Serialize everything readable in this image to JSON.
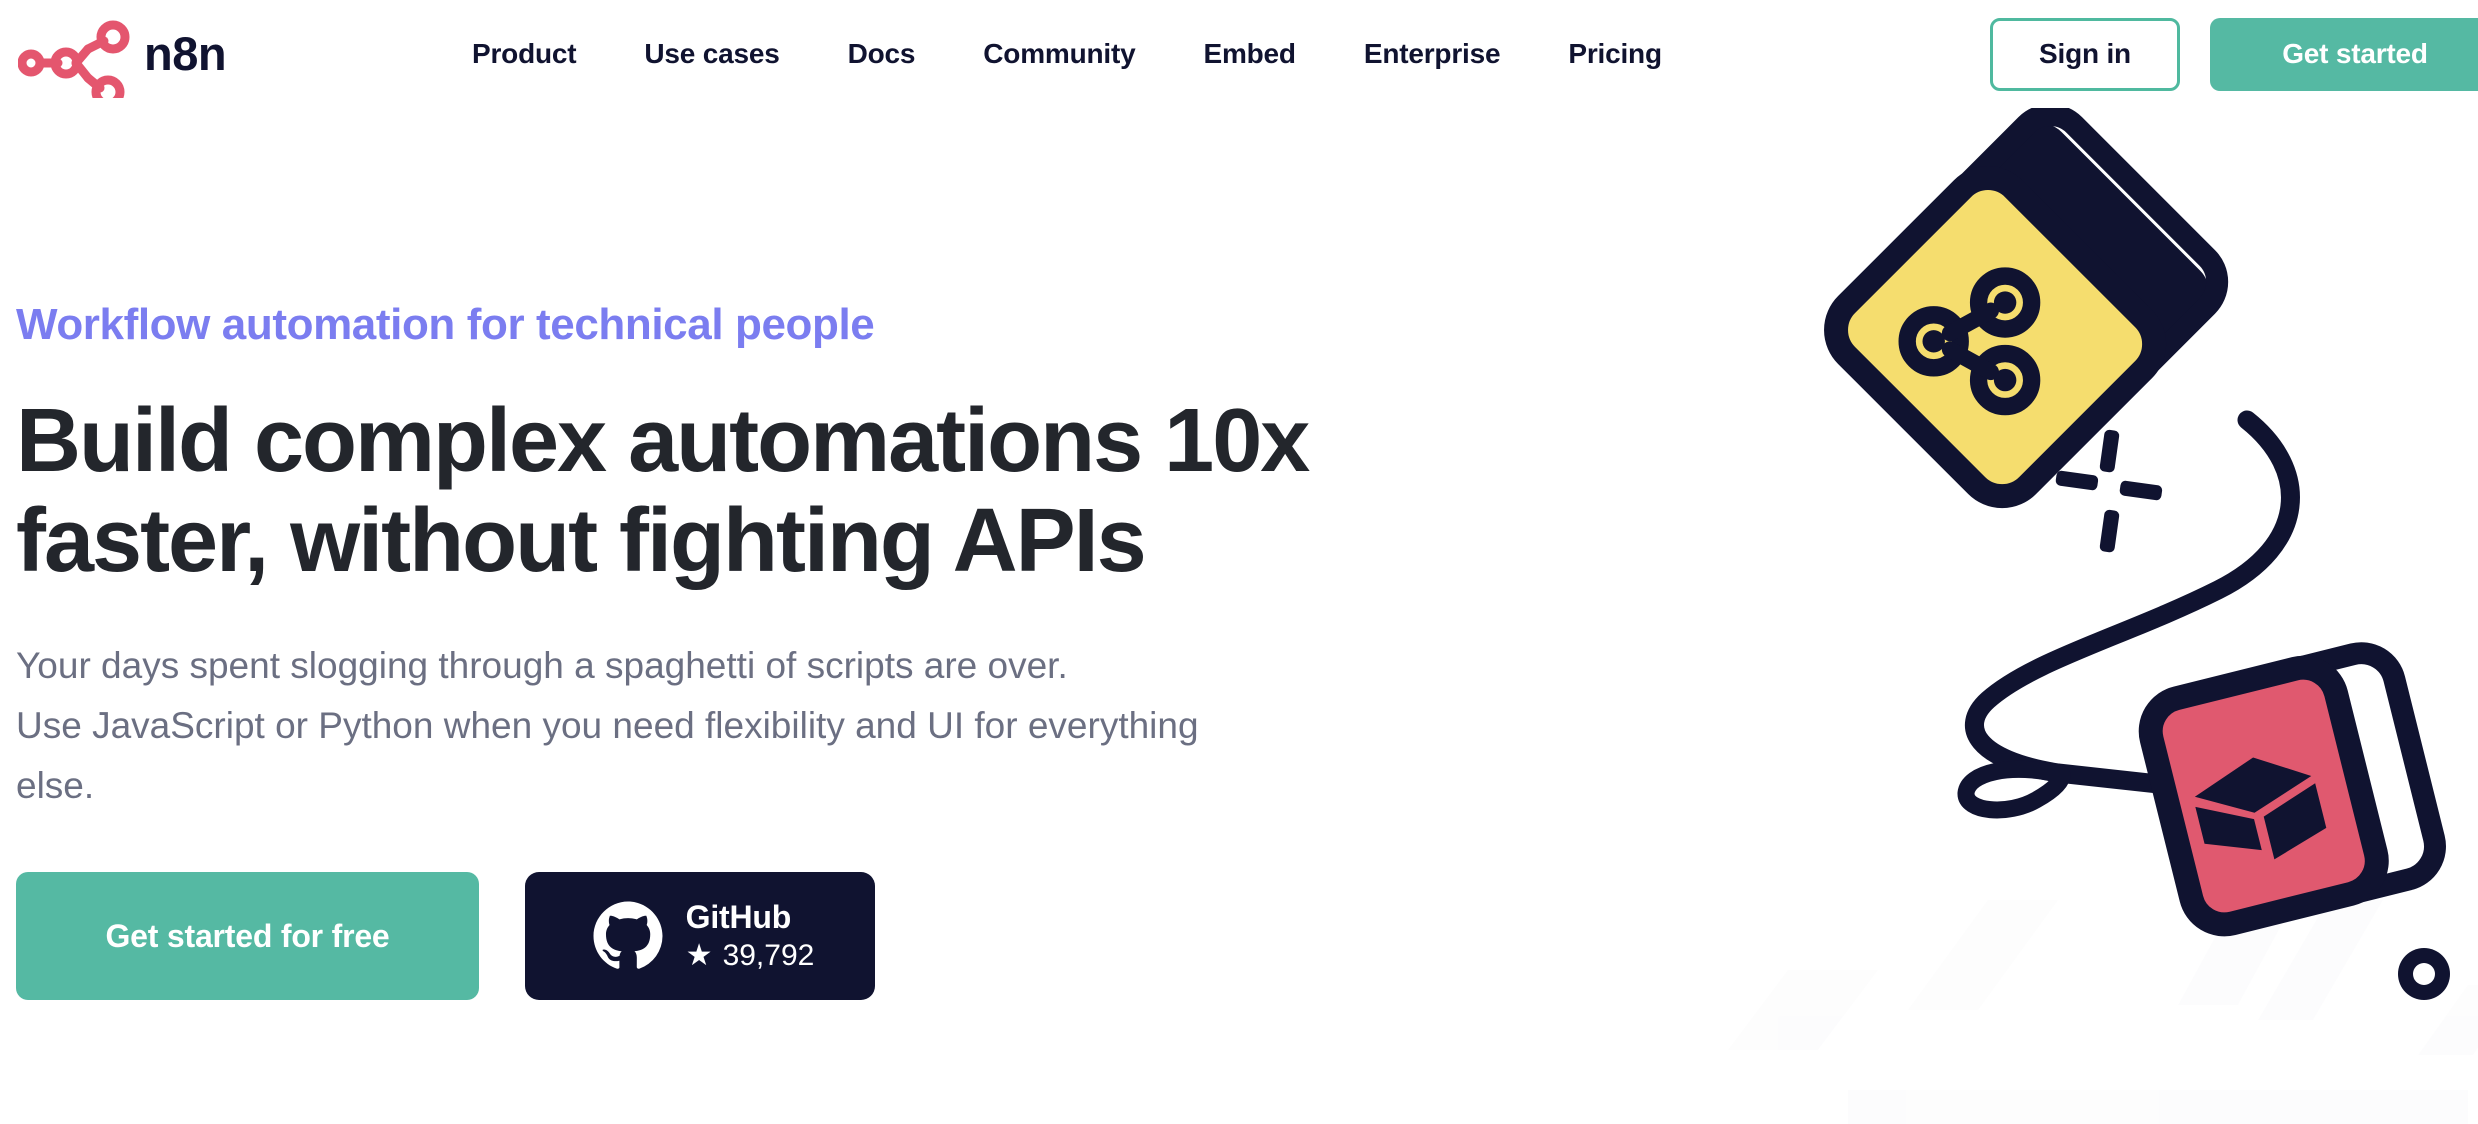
{
  "brand": {
    "name": "n8n",
    "logo_icon": "n8n-node-logo-icon",
    "logo_color": "#e4566e"
  },
  "nav": {
    "items": [
      {
        "label": "Product",
        "name": "nav-item-product"
      },
      {
        "label": "Use cases",
        "name": "nav-item-use-cases"
      },
      {
        "label": "Docs",
        "name": "nav-item-docs"
      },
      {
        "label": "Community",
        "name": "nav-item-community"
      },
      {
        "label": "Embed",
        "name": "nav-item-embed"
      },
      {
        "label": "Enterprise",
        "name": "nav-item-enterprise"
      },
      {
        "label": "Pricing",
        "name": "nav-item-pricing"
      }
    ]
  },
  "header_actions": {
    "sign_in_label": "Sign in",
    "get_started_label": "Get started"
  },
  "hero": {
    "eyebrow": "Workflow automation for technical people",
    "headline_line1": "Build complex automations 10x",
    "headline_line2": "faster, without fighting APIs",
    "subcopy_line1": "Your days spent slogging through a spaghetti of scripts are over.",
    "subcopy_line2": "Use JavaScript or Python when you need flexibility and UI for everything",
    "subcopy_line3": "else.",
    "cta_primary_label": "Get started for free",
    "github": {
      "label": "GitHub",
      "star_glyph": "★",
      "star_count": "39,792",
      "icon": "github-octocat-icon"
    }
  },
  "illustration": {
    "name": "workflow-nodes-illustration",
    "yellow_card_icon": "n8n-node-icon",
    "pink_card_icon": "package-box-icon",
    "sparkle_icon": "sparkle-icon",
    "dot_icon": "ring-dot-icon"
  },
  "colors": {
    "accent_teal": "#55b9a3",
    "accent_purple": "#7b7df0",
    "brand_pink": "#e4566e",
    "ink": "#101330",
    "heading": "#23262c",
    "body_text": "#6b6f82",
    "card_yellow": "#f5dd6e",
    "card_pink": "#e0596f"
  }
}
